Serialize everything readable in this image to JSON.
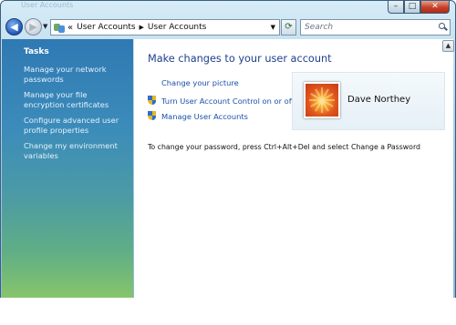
{
  "window": {
    "title": "User Accounts",
    "controls": {
      "minimize": "–",
      "maximize": "□",
      "close": "✕"
    }
  },
  "toolbar": {
    "back_glyph": "◀",
    "forward_glyph": "▶",
    "history_dropdown": "▼",
    "breadcrumb_prefix": "«",
    "breadcrumb": [
      "User Accounts",
      "User Accounts"
    ],
    "breadcrumb_separator": "▶",
    "address_dropdown": "▼",
    "refresh_glyph": "⟳",
    "search_placeholder": "Search"
  },
  "sidebar": {
    "title": "Tasks",
    "links": [
      "Manage your network passwords",
      "Manage your file encryption certificates",
      "Configure advanced user profile properties",
      "Change my environment variables"
    ]
  },
  "main": {
    "title": "Make changes to your user account",
    "actions": [
      {
        "label": "Change your picture",
        "icon": "none"
      },
      {
        "label": "Turn User Account Control on or off",
        "icon": "shield-icon"
      },
      {
        "label": "Manage User Accounts",
        "icon": "shield-icon"
      }
    ],
    "user": {
      "name": "Dave Northey"
    },
    "info_text": "To change your password, press Ctrl+Alt+Del and select Change a Password"
  },
  "scrollbar": {
    "up_glyph": "▲"
  },
  "colors": {
    "link": "#1b4fa8",
    "title": "#1e3f8c",
    "sidebar_top": "#2f79b3",
    "sidebar_bottom": "#86c56b",
    "close_button": "#c6402a"
  }
}
